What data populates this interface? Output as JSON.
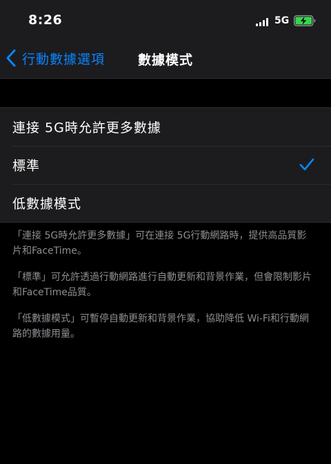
{
  "status_bar": {
    "time": "8:26",
    "network": "5G",
    "battery_charging": true,
    "battery_color": "#32d74b"
  },
  "nav": {
    "back_label": "行動數據選項",
    "title": "數據模式",
    "accent_color": "#0a84ff"
  },
  "options": [
    {
      "label": "連接 5G時允許更多數據",
      "selected": false
    },
    {
      "label": "標準",
      "selected": true
    },
    {
      "label": "低數據模式",
      "selected": false
    }
  ],
  "footer_notes": [
    "「連接 5G時允許更多數據」可在連接 5G行動網路時，提供高品質影片和FaceTime。",
    "「標準」可允許透過行動網路進行自動更新和背景作業，但會限制影片和FaceTime品質。",
    "「低數據模式」可暫停自動更新和背景作業，協助降低 Wi-Fi和行動網路的數據用量。"
  ]
}
